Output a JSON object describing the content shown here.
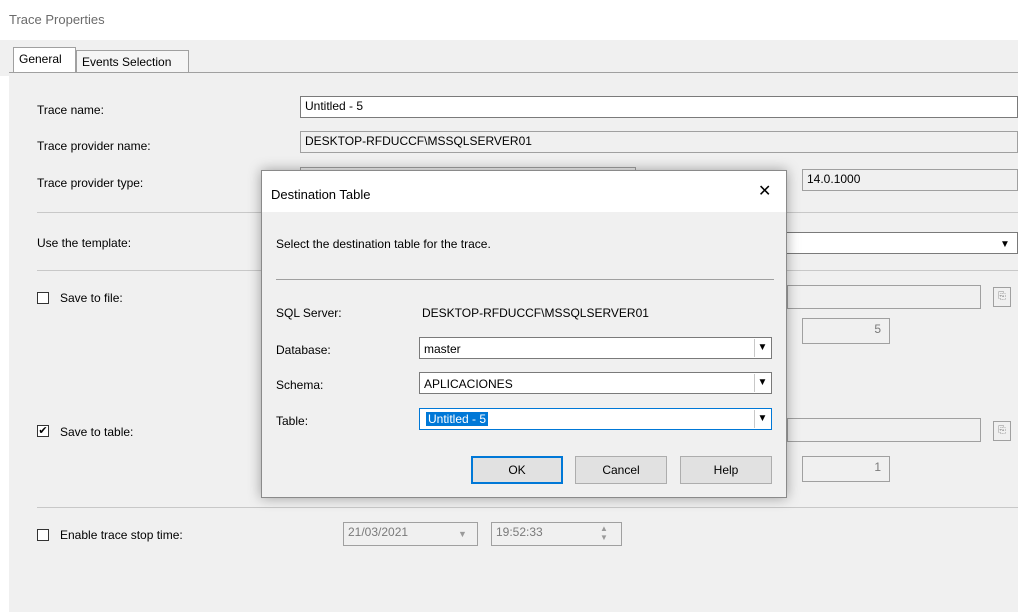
{
  "window": {
    "title": "Trace Properties"
  },
  "tabs": [
    {
      "label": "General",
      "active": true
    },
    {
      "label": "Events Selection",
      "active": false
    }
  ],
  "general": {
    "trace_name_label": "Trace name:",
    "trace_name_value": "Untitled - 5",
    "provider_name_label": "Trace provider name:",
    "provider_name_value": "DESKTOP-RFDUCCF\\MSSQLSERVER01",
    "provider_type_label": "Trace provider type:",
    "provider_version_value": "14.0.1000",
    "template_label": "Use the template:",
    "save_to_file_label": "Save to file:",
    "save_to_file_checked": false,
    "file_rollover_value": "5",
    "save_to_table_label": "Save to table:",
    "save_to_table_checked": true,
    "table_rows_value": "1",
    "stop_time_label": "Enable trace stop time:",
    "stop_time_checked": false,
    "stop_date_value": "21/03/2021",
    "stop_time_value": "19:52:33"
  },
  "dialog": {
    "title": "Destination Table",
    "close_label": "✕",
    "instruction": "Select the destination table for the trace.",
    "sql_server_label": "SQL Server:",
    "sql_server_value": "DESKTOP-RFDUCCF\\MSSQLSERVER01",
    "database_label": "Database:",
    "database_value": "master",
    "schema_label": "Schema:",
    "schema_value": "APLICACIONES",
    "table_label": "Table:",
    "table_value": "Untitled - 5",
    "ok_label": "OK",
    "cancel_label": "Cancel",
    "help_label": "Help"
  }
}
